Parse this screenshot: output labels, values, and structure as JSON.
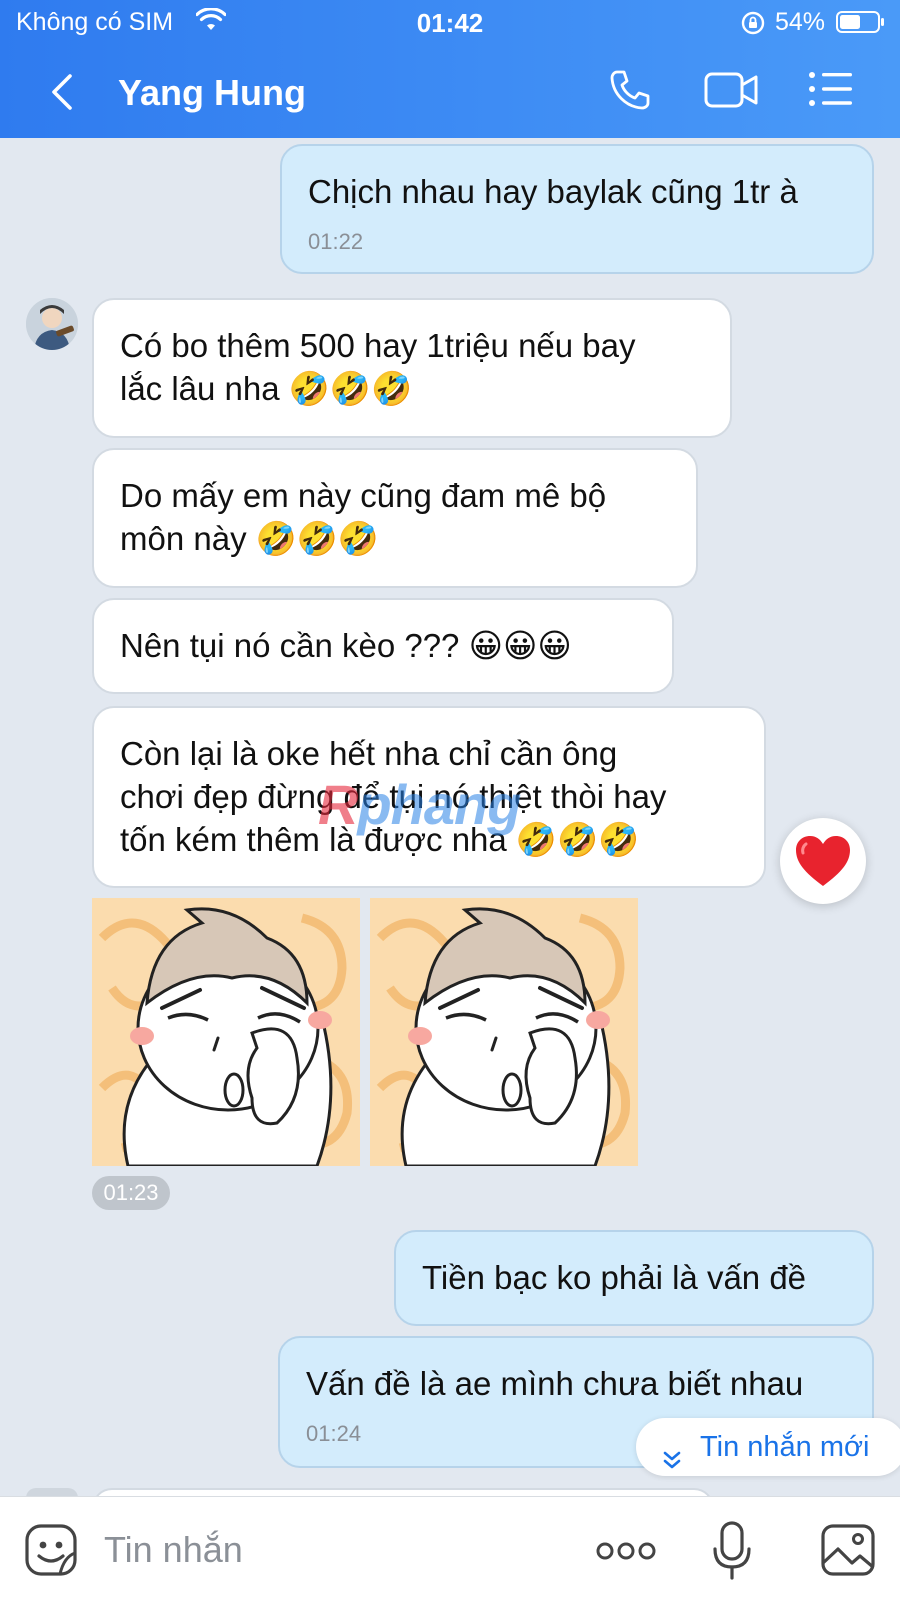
{
  "status_bar": {
    "carrier": "Không có SIM",
    "time": "01:42",
    "battery": "54%"
  },
  "nav": {
    "title": "Yang Hung"
  },
  "messages": {
    "m1": {
      "text": "Chịch nhau hay baylak cũng 1tr à",
      "time": "01:22"
    },
    "m2": {
      "line1": "Có bo thêm 500 hay 1triệu nếu bay",
      "line2": "lắc lâu nha 🤣🤣🤣"
    },
    "m3": {
      "line1": "Do mấy em này cũng đam mê bộ",
      "line2": "môn này 🤣🤣🤣"
    },
    "m4": {
      "text": "Nên tụi nó cần kèo ??? 😀😀😀"
    },
    "m5": {
      "line1": "Còn lại là oke hết nha chỉ cần ông",
      "line2": "chơi đẹp đừng để tụi nó thiệt thòi hay",
      "line3": "tốn kém thêm là được nha 🤣🤣🤣"
    },
    "sticker_time": "01:23",
    "m6": {
      "text": "Tiền bạc ko phải là vấn đề"
    },
    "m7": {
      "text": "Vấn đề là ae mình chưa biết nhau",
      "time": "01:24"
    }
  },
  "reaction": "❤️",
  "watermark": {
    "r": "R",
    "rest": "phang"
  },
  "new_message_label": "Tin nhắn mới",
  "input": {
    "placeholder": "Tin nhắn"
  },
  "colors": {
    "header_start": "#2f7bef",
    "header_end": "#4a9af8",
    "bg": "#e2e8f0",
    "outgoing": "#d3ecfc",
    "incoming": "#ffffff",
    "link": "#1a73e8"
  },
  "icons": [
    "wifi-icon",
    "lock-rotation-icon",
    "battery-icon",
    "back-icon",
    "phone-icon",
    "video-icon",
    "menu-icon",
    "heart-icon",
    "chevron-down-icon",
    "emoji-icon",
    "more-icon",
    "mic-icon",
    "image-icon"
  ]
}
